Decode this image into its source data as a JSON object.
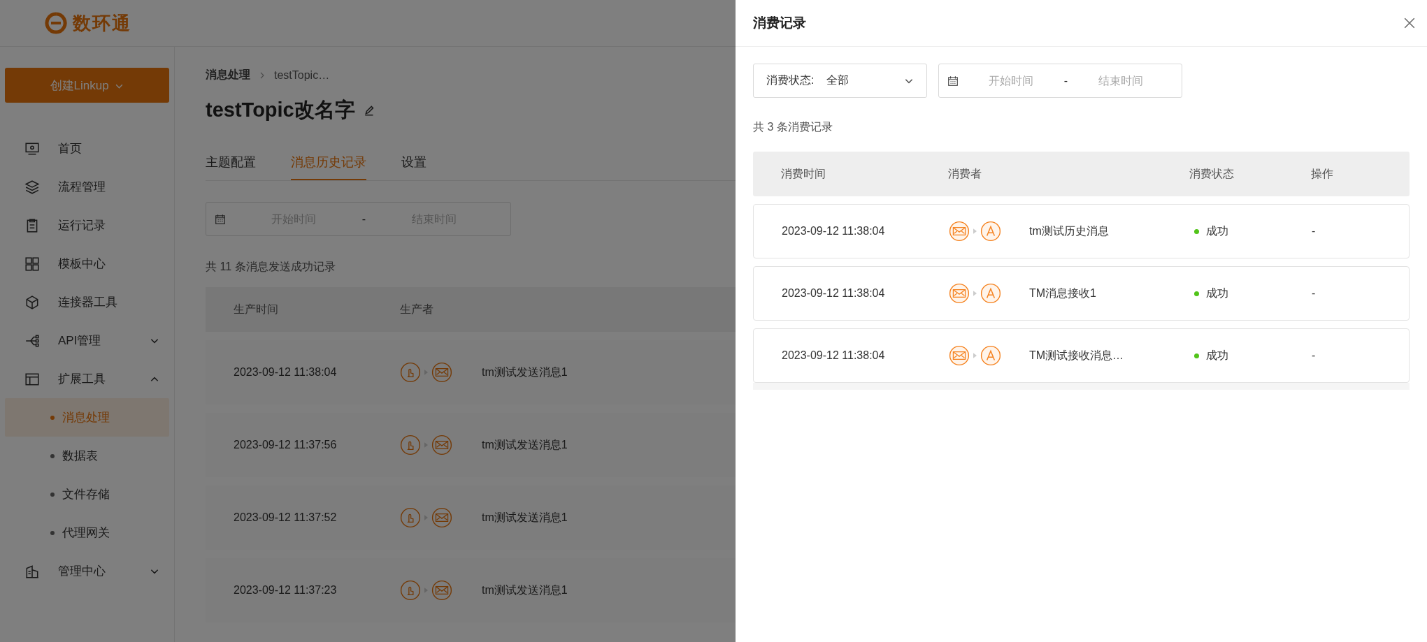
{
  "logo": {
    "text": "数环通"
  },
  "create_button": {
    "label": "创建Linkup"
  },
  "sidebar": {
    "items": [
      {
        "label": "首页",
        "selected": false
      },
      {
        "label": "流程管理",
        "selected": false
      },
      {
        "label": "运行记录",
        "selected": false
      },
      {
        "label": "模板中心",
        "selected": false
      },
      {
        "label": "连接器工具",
        "selected": false
      },
      {
        "label": "API管理",
        "selected": false,
        "expanded": false
      },
      {
        "label": "扩展工具",
        "selected": false,
        "expanded": true,
        "children": [
          {
            "label": "消息处理",
            "selected": true
          },
          {
            "label": "数据表",
            "selected": false
          },
          {
            "label": "文件存储",
            "selected": false
          },
          {
            "label": "代理网关",
            "selected": false
          }
        ]
      },
      {
        "label": "管理中心",
        "selected": false,
        "expanded": false
      }
    ]
  },
  "breadcrumb": [
    "消息处理",
    "testTopic…"
  ],
  "page_title": "testTopic改名字",
  "tabs": [
    {
      "label": "主题配置",
      "selected": false
    },
    {
      "label": "消息历史记录",
      "selected": true
    },
    {
      "label": "设置",
      "selected": false
    }
  ],
  "date_range": {
    "start_placeholder": "开始时间",
    "separator": "-",
    "end_placeholder": "结束时间"
  },
  "record_count": "共 11 条消息发送成功记录",
  "table": {
    "columns": [
      "生产时间",
      "生产者"
    ],
    "rows": [
      {
        "time": "2023-09-12 11:38:04",
        "producer": "tm测试发送消息1"
      },
      {
        "time": "2023-09-12 11:37:56",
        "producer": "tm测试发送消息1"
      },
      {
        "time": "2023-09-12 11:37:52",
        "producer": "tm测试发送消息1"
      },
      {
        "time": "2023-09-12 11:37:23",
        "producer": "tm测试发送消息1"
      }
    ]
  },
  "drawer": {
    "title": "消费记录",
    "status_filter": {
      "label": "消费状态:",
      "value": "全部"
    },
    "date_range": {
      "start_placeholder": "开始时间",
      "separator": "-",
      "end_placeholder": "结束时间"
    },
    "record_count": "共 3 条消费记录",
    "columns": [
      "消费时间",
      "消费者",
      "消费状态",
      "操作"
    ],
    "rows": [
      {
        "time": "2023-09-12 11:38:04",
        "consumer": "tm测试历史消息",
        "status": "成功",
        "color": "#52c41a",
        "action": "-"
      },
      {
        "time": "2023-09-12 11:38:04",
        "consumer": "TM消息接收1",
        "status": "成功",
        "color": "#52c41a",
        "action": "-"
      },
      {
        "time": "2023-09-12 11:38:04",
        "consumer": "TM测试接收消息…",
        "status": "成功",
        "color": "#52c41a",
        "action": "-"
      }
    ]
  }
}
